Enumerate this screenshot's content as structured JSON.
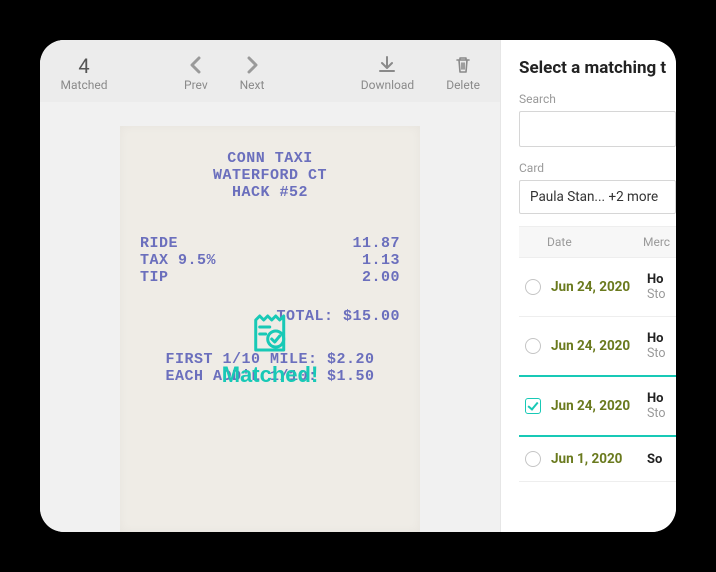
{
  "toolbar": {
    "matched_count": "4",
    "matched_label": "Matched",
    "prev_label": "Prev",
    "next_label": "Next",
    "download_label": "Download",
    "delete_label": "Delete"
  },
  "receipt": {
    "line1": "CONN TAXI",
    "line2": "WATERFORD CT",
    "line3": "HACK #52",
    "items": [
      {
        "label": "RIDE",
        "value": "11.87"
      },
      {
        "label": "TAX 9.5%",
        "value": "1.13"
      },
      {
        "label": "TIP",
        "value": "2.00"
      }
    ],
    "total": "TOTAL: $15.00",
    "foot1": "FIRST 1/10 MILE: $2.20",
    "foot2": "EACH ADD'L 1/10: $1.50"
  },
  "overlay": {
    "label": "Matched!"
  },
  "side": {
    "title": "Select a matching t",
    "search_label": "Search",
    "search_value": "",
    "card_label": "Card",
    "card_value": "Paula Stan... +2 more",
    "col_date": "Date",
    "col_merc": "Merc",
    "rows": [
      {
        "date": "Jun 24, 2020",
        "m1": "Ho",
        "m2": "Sto",
        "selected": false
      },
      {
        "date": "Jun 24, 2020",
        "m1": "Ho",
        "m2": "Sto",
        "selected": false
      },
      {
        "date": "Jun 24, 2020",
        "m1": "Ho",
        "m2": "Sto",
        "selected": true
      },
      {
        "date": "Jun 1, 2020",
        "m1": "So",
        "m2": "",
        "selected": false
      }
    ]
  }
}
